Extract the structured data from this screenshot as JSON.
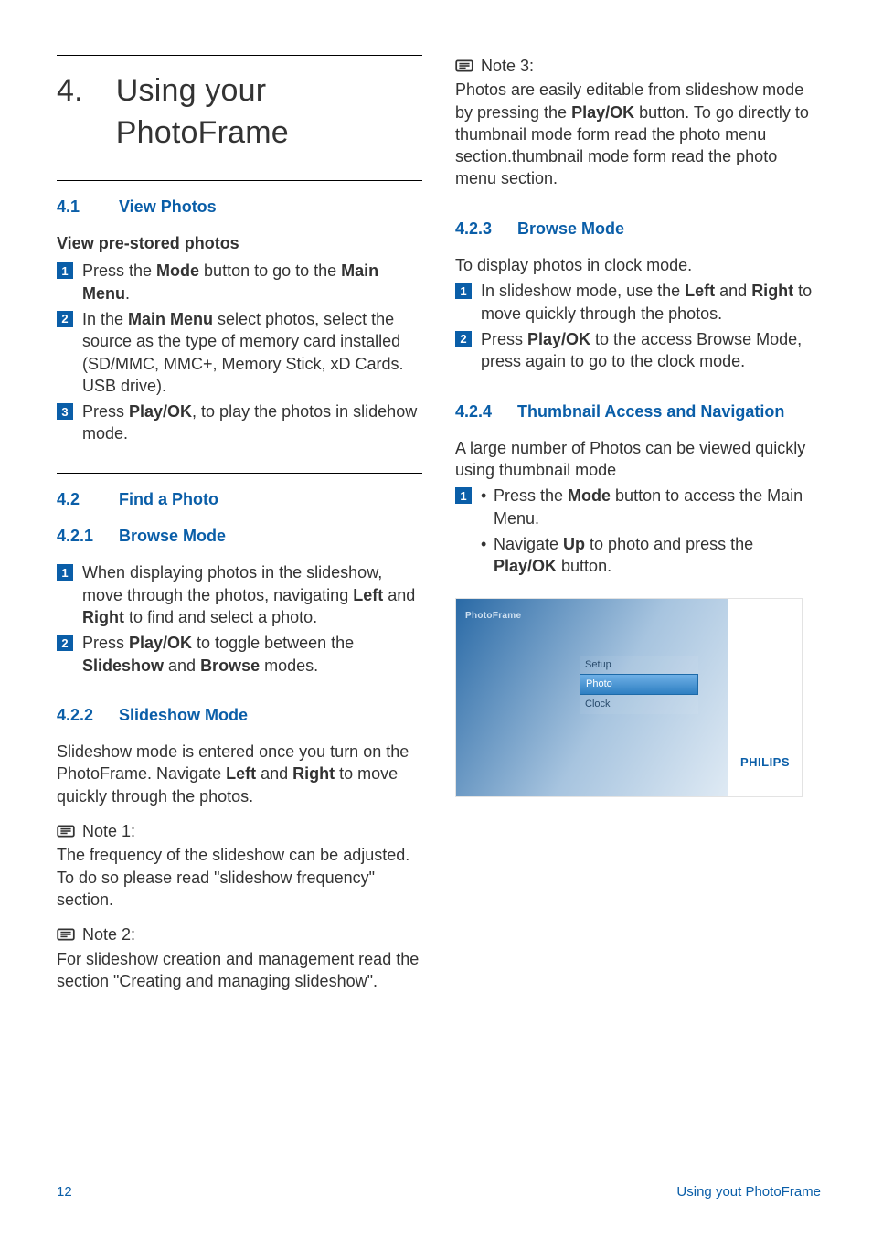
{
  "chapter": {
    "number": "4.",
    "title": "Using your PhotoFrame"
  },
  "left": {
    "s41": {
      "num": "4.1",
      "title": "View Photos"
    },
    "prestored_heading": "View pre-stored photos",
    "steps_41": [
      "Press the  <b>Mode</b> button to go to the <b>Main Menu</b>.",
      "In the <b>Main Menu</b> select photos, select the source as the type of memory card installed (SD/MMC, MMC+, Memory Stick,  xD Cards. USB drive).",
      "Press <b>Play/OK</b>, to play the photos in slidehow mode."
    ],
    "s42": {
      "num": "4.2",
      "title": "Find a Photo"
    },
    "s421": {
      "num": "4.2.1",
      "title": "Browse Mode"
    },
    "steps_421": [
      "When displaying photos in the slideshow, move through the photos, navigating <b>Left</b> and <b>Right</b> to find and select a photo.",
      "Press <b>Play/OK</b> to toggle between the <b>Slideshow</b> and <b>Browse</b> modes."
    ],
    "s422": {
      "num": "4.2.2",
      "title": "Slideshow Mode"
    },
    "p422": "Slideshow mode is entered once you turn on the PhotoFrame. Navigate <b>Left</b> and <b>Right</b> to move quickly through the photos.",
    "note1_label": "Note 1:",
    "note1_body": "The frequency of the slideshow can be adjusted. To do so please read \"slideshow frequency\" section.",
    "note2_label": "Note 2:",
    "note2_body": "For slideshow creation and management read the section \"Creating and managing slideshow\"."
  },
  "right": {
    "note3_label": "Note 3:",
    "note3_body": "Photos are easily editable from slideshow mode by pressing the <b>Play/OK</b> button. To go directly to thumbnail mode form read the photo menu section.thumbnail mode form read the photo menu section.",
    "s423": {
      "num": "4.2.3",
      "title": "Browse Mode"
    },
    "p423_intro": "To display photos in clock mode.",
    "steps_423": [
      "In slideshow mode, use the <b>Left</b> and <b>Right</b> to move quickly through the photos.",
      "Press <b>Play/OK</b> to the access Browse Mode, press again to go to the clock mode."
    ],
    "s424": {
      "num": "4.2.4",
      "title": "Thumbnail Access and Navigation"
    },
    "p424_intro": "A large number of Photos can be viewed quickly using thumbnail mode",
    "step424_bullets": [
      "Press the <b>Mode</b> button to access the Main Menu.",
      "Navigate <b>Up</b> to photo and press the <b>Play/OK</b> button."
    ],
    "screenshot": {
      "pf_label": "PhotoFrame",
      "menu_items": [
        "Setup",
        "Photo",
        "Clock"
      ],
      "selected_index": 1,
      "brand": "PHILIPS"
    }
  },
  "footer": {
    "page": "12",
    "label": "Using yout PhotoFrame"
  }
}
